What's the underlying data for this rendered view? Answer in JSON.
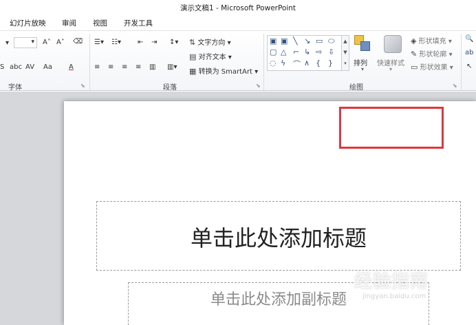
{
  "window": {
    "title": "演示文稿1 - Microsoft PowerPoint"
  },
  "tabs": [
    "幻灯片放映",
    "审阅",
    "视图",
    "开发工具"
  ],
  "ribbon": {
    "font_group": {
      "label": "字体",
      "grow_font": "A˄",
      "shrink_font": "A˅",
      "strikethrough": "abc",
      "char_spacing": "AV",
      "change_case": "Aa",
      "font_color": "A"
    },
    "paragraph_group": {
      "label": "段落",
      "text_direction": "文字方向",
      "align_text": "对齐文本",
      "convert_smartart": "转换为 SmartArt"
    },
    "drawing_group": {
      "label": "绘图",
      "arrange": "排列",
      "quick_styles": "快速样式",
      "shape_fill": "形状填充",
      "shape_outline": "形状轮廓",
      "shape_effects": "形状效果"
    }
  },
  "slide": {
    "title_placeholder": "单击此处添加标题",
    "subtitle_placeholder": "单击此处添加副标题"
  },
  "watermark": {
    "main": "经验指南",
    "sub": "jingyan.baidu.com"
  },
  "colors": {
    "highlight": "#e0363b",
    "workspace": "#d5d7db"
  }
}
